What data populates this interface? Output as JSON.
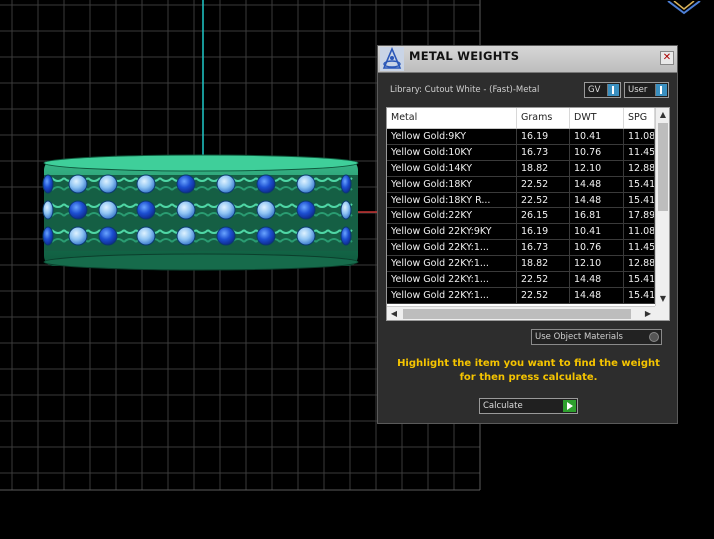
{
  "dialog": {
    "title": "METAL WEIGHTS",
    "close_glyph": "✕",
    "library": "Library: Cutout White - (Fast)-Metal",
    "gv_label": "GV",
    "user_label": "User",
    "use_object_materials": "Use Object Materials",
    "hint": "Highlight the item you want to find the weight for then press calculate.",
    "calculate_label": "Calculate"
  },
  "table": {
    "columns": [
      "Metal",
      "Grams",
      "DWT",
      "SPG"
    ],
    "rows": [
      [
        "Yellow Gold:9KY",
        "16.19",
        "10.41",
        "11.08"
      ],
      [
        "Yellow Gold:10KY",
        "16.73",
        "10.76",
        "11.45"
      ],
      [
        "Yellow Gold:14KY",
        "18.82",
        "12.10",
        "12.88"
      ],
      [
        "Yellow Gold:18KY",
        "22.52",
        "14.48",
        "15.41"
      ],
      [
        "Yellow Gold:18KY R...",
        "22.52",
        "14.48",
        "15.41"
      ],
      [
        "Yellow Gold:22KY",
        "26.15",
        "16.81",
        "17.89"
      ],
      [
        "Yellow Gold 22KY:9KY",
        "16.19",
        "10.41",
        "11.08"
      ],
      [
        "Yellow Gold 22KY:1...",
        "16.73",
        "10.76",
        "11.45"
      ],
      [
        "Yellow Gold 22KY:1...",
        "18.82",
        "12.10",
        "12.88"
      ],
      [
        "Yellow Gold 22KY:1...",
        "22.52",
        "14.48",
        "15.41"
      ],
      [
        "Yellow Gold 22KY:1...",
        "22.52",
        "14.48",
        "15.41"
      ]
    ]
  },
  "icons": {
    "app_logo": "app-logo-icon",
    "dialog": "metal-weights-icon",
    "scroll_up": "▲",
    "scroll_down": "▼",
    "scroll_left": "◀",
    "scroll_right": "▶"
  },
  "colors": {
    "viewport_bg": "#000000",
    "grid_line": "#3a3a3a",
    "axis_line": "#1fc9c9",
    "ring_body": "#1f8a62",
    "hint_text": "#f5c400",
    "toggle_indicator": "#3a8fbf",
    "calculate_go": "#2ea02e"
  }
}
